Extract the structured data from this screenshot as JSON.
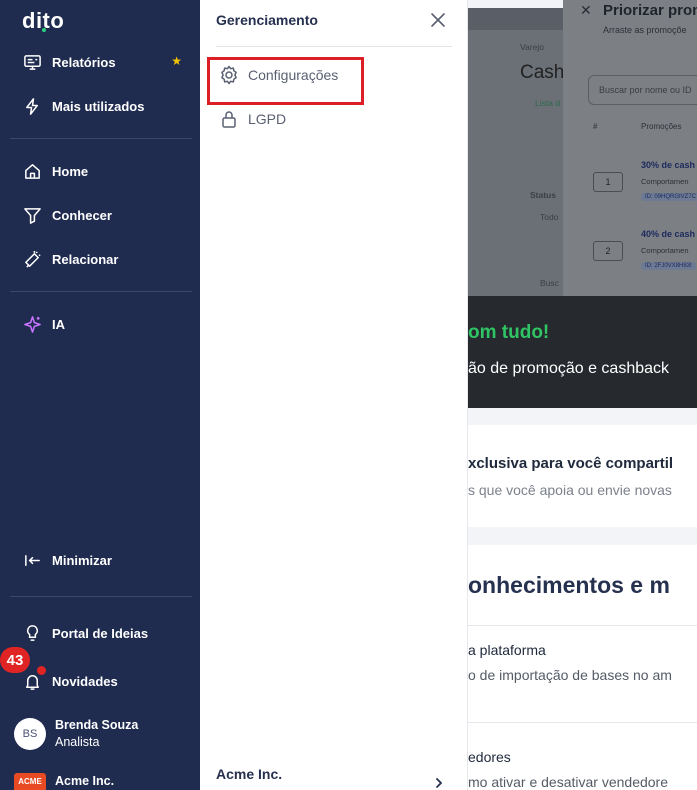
{
  "sidebar": {
    "logo": "dito",
    "items": [
      {
        "label": "Relatórios",
        "icon": "report-icon",
        "starred": true
      },
      {
        "label": "Mais utilizados",
        "icon": "lightning-icon"
      },
      {
        "label": "Home",
        "icon": "home-icon"
      },
      {
        "label": "Conhecer",
        "icon": "filter-icon"
      },
      {
        "label": "Relacionar",
        "icon": "megaphone-icon"
      },
      {
        "label": "IA",
        "icon": "sparkle-icon"
      }
    ],
    "minimize_label": "Minimizar",
    "bottom_items": [
      {
        "label": "Portal de Ideias",
        "icon": "lightbulb-icon"
      },
      {
        "label": "Novidades",
        "icon": "bell-icon"
      }
    ],
    "notification_count": "43",
    "user": {
      "initials": "BS",
      "name": "Brenda Souza",
      "role": "Analista"
    },
    "company": {
      "logo_text": "ACME",
      "name": "Acme Inc."
    }
  },
  "panel": {
    "title": "Gerenciamento",
    "items": [
      {
        "label": "Configurações",
        "icon": "gear-icon",
        "highlighted": true
      },
      {
        "label": "LGPD",
        "icon": "lock-icon"
      }
    ],
    "company": "Acme Inc.",
    "highlight_color": "#dc1f26"
  },
  "background": {
    "breadcrumb": "Varejo",
    "page_title": "Cash",
    "tab": "Lista d",
    "status_label": "Status",
    "status_value": "Todo",
    "search_stub": "Busc",
    "modal": {
      "title": "Priorizar promo",
      "subtitle": "Arraste as promoçõe",
      "search_placeholder": "Buscar por nome ou ID",
      "col_number": "#",
      "col_promo": "Promoções",
      "rows": [
        {
          "num": "1",
          "name": "30% de cash",
          "desc": "Comportamen",
          "id": "ID: 09HQRGIVZ7C"
        },
        {
          "num": "2",
          "name": "40% de cash",
          "desc": "Comportamen",
          "id": "ID: 2FJ0VX8H83I"
        }
      ]
    },
    "banner": {
      "title": "om tudo!",
      "subtitle": "ão de promoção e cashback"
    },
    "section1": {
      "title": "xclusiva para você compartil",
      "subtitle": "s que você apoia ou envie novas"
    },
    "section2": {
      "heading": "onhecimentos e m",
      "item1_title": "a plataforma",
      "item1_sub": "o de importação de bases no am",
      "item2_title": "edores",
      "item2_sub": "mo ativar e desativar vendedore"
    }
  },
  "colors": {
    "sidebar_bg": "#1f2b4f",
    "accent_green": "#2fc564",
    "badge_red": "#e02424",
    "star_yellow": "#f5c400"
  }
}
